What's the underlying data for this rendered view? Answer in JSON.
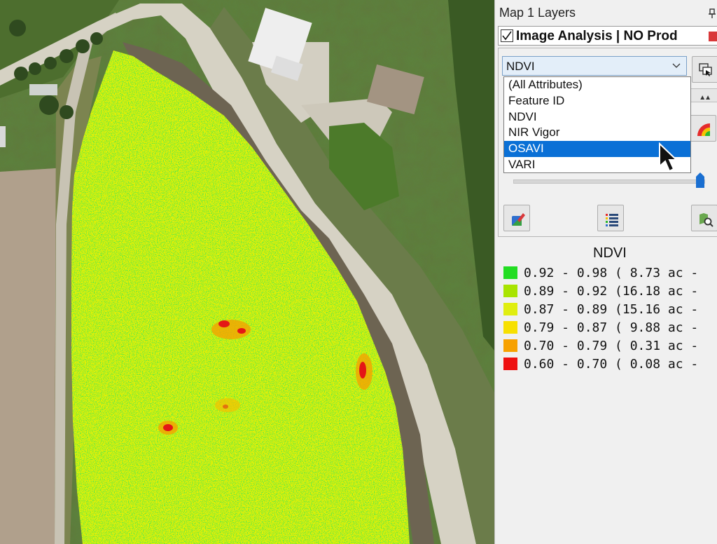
{
  "panel": {
    "title": "Map 1 Layers",
    "layer_label": "Image Analysis  |  NO Prod"
  },
  "attribute_dropdown": {
    "selected": "NDVI",
    "options": [
      {
        "label": "(All Attributes)"
      },
      {
        "label": "Feature ID"
      },
      {
        "label": "NDVI"
      },
      {
        "label": "NIR Vigor"
      },
      {
        "label": "OSAVI",
        "highlighted": true
      },
      {
        "label": "VARI"
      }
    ]
  },
  "transparency_slider": {
    "value_fraction": 0.98
  },
  "icons": {
    "dropdown_side": "layer-select-icon",
    "color_ramp": "color-ramp-icon",
    "edit_layer": "edit-layer-icon",
    "list": "list-icon",
    "zoom_map": "zoom-map-icon",
    "pin": "pin-icon"
  },
  "legend": {
    "title": "NDVI",
    "rows": [
      {
        "text": "0.92 - 0.98 ( 8.73 ac -",
        "color": "#22dd22"
      },
      {
        "text": "0.89 - 0.92 (16.18 ac -",
        "color": "#a8e400"
      },
      {
        "text": "0.87 - 0.89 (15.16 ac -",
        "color": "#e0ee10"
      },
      {
        "text": "0.79 - 0.87 ( 9.88 ac -",
        "color": "#f7e000"
      },
      {
        "text": "0.70 - 0.79 ( 0.31 ac -",
        "color": "#f7a100"
      },
      {
        "text": "0.60 - 0.70 ( 0.08 ac -",
        "color": "#ee1111"
      }
    ]
  },
  "colors": {
    "selection_blue": "#0a70d6",
    "close_red": "#d9383a",
    "slider_blue": "#1a6fd1"
  }
}
